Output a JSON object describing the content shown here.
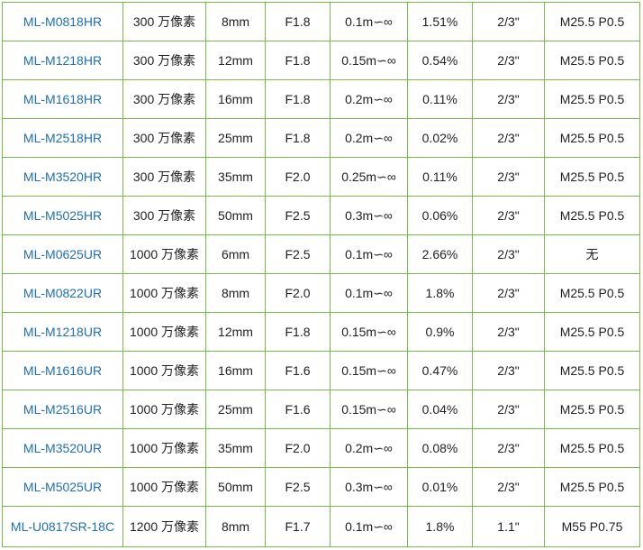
{
  "table": {
    "rows": [
      {
        "model": "ML-M0818HR",
        "resolution": "300 万像素",
        "focal": "8mm",
        "aperture": "F1.8",
        "distance": "0.1m∽∞",
        "distortion": "1.51%",
        "sensor": "2/3\"",
        "mount": "M25.5 P0.5"
      },
      {
        "model": "ML-M1218HR",
        "resolution": "300 万像素",
        "focal": "12mm",
        "aperture": "F1.8",
        "distance": "0.15m∽∞",
        "distortion": "0.54%",
        "sensor": "2/3\"",
        "mount": "M25.5 P0.5"
      },
      {
        "model": "ML-M1618HR",
        "resolution": "300 万像素",
        "focal": "16mm",
        "aperture": "F1.8",
        "distance": "0.2m∽∞",
        "distortion": "0.11%",
        "sensor": "2/3\"",
        "mount": "M25.5 P0.5"
      },
      {
        "model": "ML-M2518HR",
        "resolution": "300 万像素",
        "focal": "25mm",
        "aperture": "F1.8",
        "distance": "0.2m∽∞",
        "distortion": "0.02%",
        "sensor": "2/3\"",
        "mount": "M25.5 P0.5"
      },
      {
        "model": "ML-M3520HR",
        "resolution": "300 万像素",
        "focal": "35mm",
        "aperture": "F2.0",
        "distance": "0.25m∽∞",
        "distortion": "0.11%",
        "sensor": "2/3\"",
        "mount": "M25.5 P0.5"
      },
      {
        "model": "ML-M5025HR",
        "resolution": "300 万像素",
        "focal": "50mm",
        "aperture": "F2.5",
        "distance": "0.3m∽∞",
        "distortion": "0.06%",
        "sensor": "2/3\"",
        "mount": "M25.5 P0.5"
      },
      {
        "model": "ML-M0625UR",
        "resolution": "1000 万像素",
        "focal": "6mm",
        "aperture": "F2.5",
        "distance": "0.1m∽∞",
        "distortion": "2.66%",
        "sensor": "2/3\"",
        "mount": "无"
      },
      {
        "model": "ML-M0822UR",
        "resolution": "1000 万像素",
        "focal": "8mm",
        "aperture": "F2.0",
        "distance": "0.1m∽∞",
        "distortion": "1.8%",
        "sensor": "2/3\"",
        "mount": "M25.5 P0.5"
      },
      {
        "model": "ML-M1218UR",
        "resolution": "1000 万像素",
        "focal": "12mm",
        "aperture": "F1.8",
        "distance": "0.15m∽∞",
        "distortion": "0.9%",
        "sensor": "2/3\"",
        "mount": "M25.5 P0.5"
      },
      {
        "model": "ML-M1616UR",
        "resolution": "1000 万像素",
        "focal": "16mm",
        "aperture": "F1.6",
        "distance": "0.15m∽∞",
        "distortion": "0.47%",
        "sensor": "2/3\"",
        "mount": "M25.5 P0.5"
      },
      {
        "model": "ML-M2516UR",
        "resolution": "1000 万像素",
        "focal": "25mm",
        "aperture": "F1.6",
        "distance": "0.15m∽∞",
        "distortion": "0.04%",
        "sensor": "2/3\"",
        "mount": "M25.5 P0.5"
      },
      {
        "model": "ML-M3520UR",
        "resolution": "1000 万像素",
        "focal": "35mm",
        "aperture": "F2.0",
        "distance": "0.2m∽∞",
        "distortion": "0.08%",
        "sensor": "2/3\"",
        "mount": "M25.5 P0.5"
      },
      {
        "model": "ML-M5025UR",
        "resolution": "1000 万像素",
        "focal": "50mm",
        "aperture": "F2.5",
        "distance": "0.3m∽∞",
        "distortion": "0.01%",
        "sensor": "2/3\"",
        "mount": "M25.5 P0.5"
      },
      {
        "model": "ML-U0817SR-18C",
        "resolution": "1200 万像素",
        "focal": "8mm",
        "aperture": "F1.7",
        "distance": "0.1m∽∞",
        "distortion": "1.8%",
        "sensor": "1.1\"",
        "mount": "M55 P0.75"
      }
    ]
  },
  "colors": {
    "border": "#7ab84c",
    "model_link": "#1f6fb2",
    "text": "#222222"
  }
}
